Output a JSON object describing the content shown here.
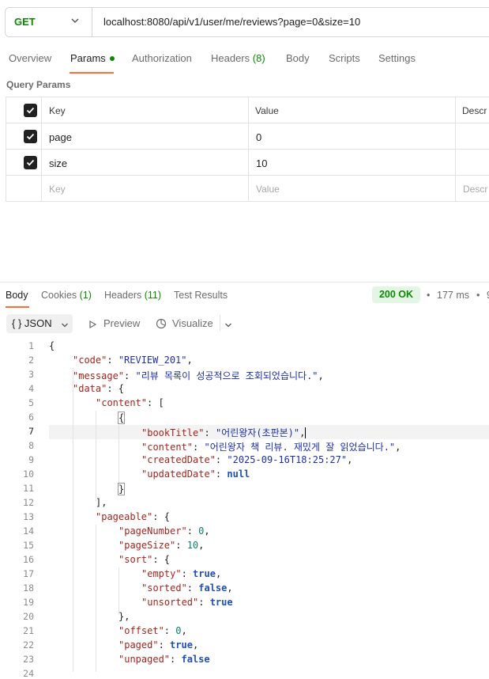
{
  "request": {
    "method": "GET",
    "url": "localhost:8080/api/v1/user/me/reviews?page=0&size=10"
  },
  "request_tabs": [
    {
      "label": "Overview"
    },
    {
      "label": "Params"
    },
    {
      "label": "Authorization"
    },
    {
      "label": "Headers",
      "count": "(8)"
    },
    {
      "label": "Body"
    },
    {
      "label": "Scripts"
    },
    {
      "label": "Settings"
    }
  ],
  "query_params": {
    "title": "Query Params",
    "headers": {
      "key": "Key",
      "value": "Value",
      "description": "Descr"
    },
    "rows": [
      {
        "key": "page",
        "value": "0"
      },
      {
        "key": "size",
        "value": "10"
      }
    ],
    "placeholder": {
      "key": "Key",
      "value": "Value",
      "description": "Descr"
    }
  },
  "response_tabs": [
    {
      "label": "Body"
    },
    {
      "label": "Cookies",
      "count": "(1)"
    },
    {
      "label": "Headers",
      "count": "(11)"
    },
    {
      "label": "Test Results"
    }
  ],
  "response_meta": {
    "status": "200 OK",
    "time": "177 ms",
    "dot": "•",
    "cut": "9"
  },
  "format_toolbar": {
    "braces": "{ }",
    "format": "JSON",
    "preview": "Preview",
    "visualize": "Visualize"
  },
  "json_lines": {
    "l1_open": "{",
    "code_key": "\"code\"",
    "code_val": "\"REVIEW_201\"",
    "message_key": "\"message\"",
    "message_val": "\"리뷰 목록이 성공적으로 조회되었습니다.\"",
    "data_key": "\"data\"",
    "content_key": "\"content\"",
    "obj_open": "{",
    "bookTitle_key": "\"bookTitle\"",
    "bookTitle_val": "\"어린왕자(초판본)\"",
    "contentf_key": "\"content\"",
    "contentf_val": "\"어린왕자 책 리뷰. 재밌게 잘 읽었습니다.\"",
    "createdDate_key": "\"createdDate\"",
    "createdDate_val": "\"2025-09-16T18:25:27\"",
    "updatedDate_key": "\"updatedDate\"",
    "updatedDate_val": "null",
    "obj_close": "}",
    "arr_close": "],",
    "pageable_key": "\"pageable\"",
    "pageNumber_key": "\"pageNumber\"",
    "pageNumber_val": "0",
    "pageSize_key": "\"pageSize\"",
    "pageSize_val": "10",
    "sort_key": "\"sort\"",
    "empty_key": "\"empty\"",
    "empty_val": "true",
    "sorted_key": "\"sorted\"",
    "sorted_val": "false",
    "unsorted_key": "\"unsorted\"",
    "unsorted_val": "true",
    "sort_close": "},",
    "offset_key": "\"offset\"",
    "offset_val": "0",
    "paged_key": "\"paged\"",
    "paged_val": "true",
    "unpaged_key": "\"unpaged\"",
    "unpaged_val": "false"
  },
  "line_numbers": [
    "1",
    "2",
    "3",
    "4",
    "5",
    "6",
    "7",
    "8",
    "9",
    "10",
    "11",
    "12",
    "13",
    "14",
    "15",
    "16",
    "17",
    "18",
    "19",
    "20",
    "21",
    "22",
    "23",
    "24"
  ]
}
